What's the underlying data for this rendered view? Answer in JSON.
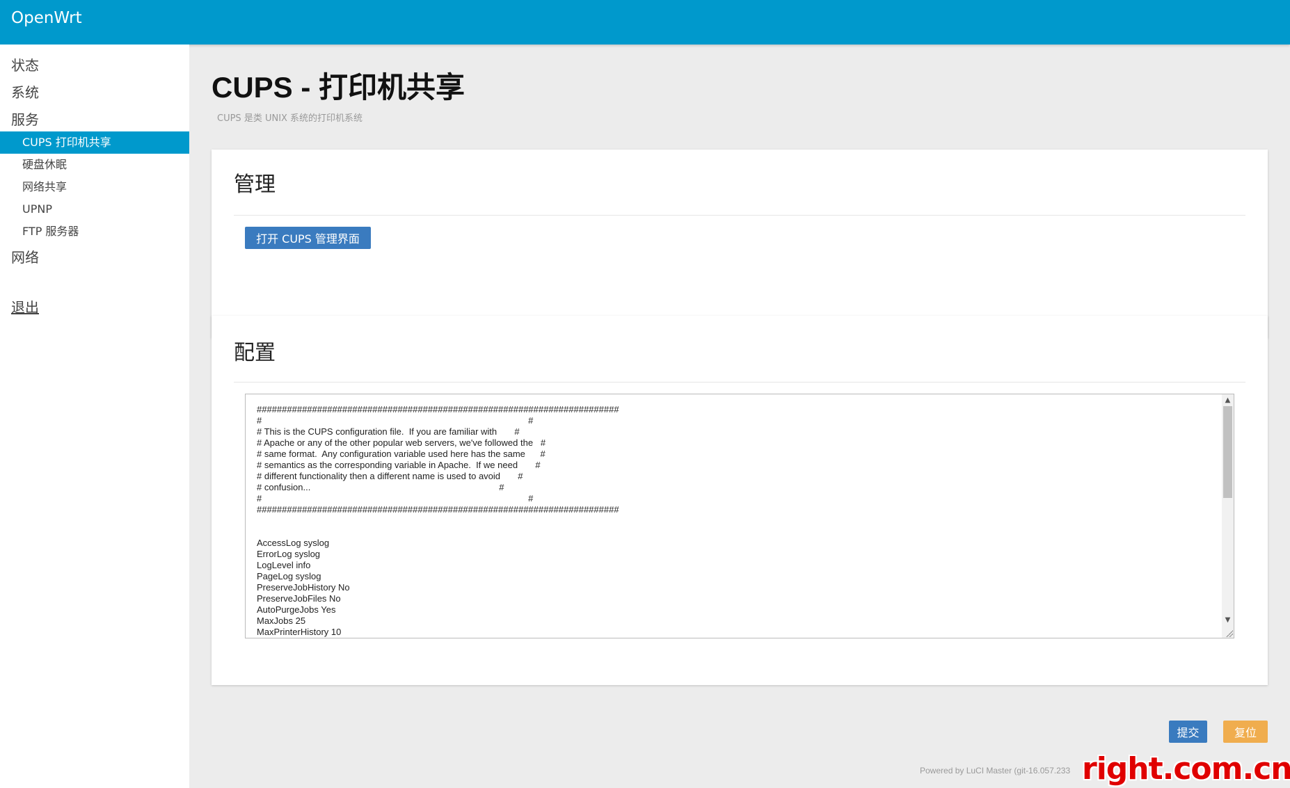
{
  "header": {
    "brand": "OpenWrt"
  },
  "sidebar": {
    "status": "状态",
    "system": "系统",
    "services": "服务",
    "services_items": [
      "CUPS 打印机共享",
      "硬盘休眠",
      "网络共享",
      "UPNP",
      "FTP 服务器"
    ],
    "network": "网络",
    "logout": "退出"
  },
  "page": {
    "title": "CUPS - 打印机共享",
    "description": "CUPS 是类 UNIX 系统的打印机系统"
  },
  "manage_section": {
    "title": "管理",
    "open_button": "打开 CUPS 管理界面"
  },
  "config_section": {
    "title": "配置",
    "content": "########################################################################\n#                                                                                                          #\n# This is the CUPS configuration file.  If you are familiar with       #\n# Apache or any of the other popular web servers, we've followed the   #\n# same format.  Any configuration variable used here has the same      #\n# semantics as the corresponding variable in Apache.  If we need       #\n# different functionality then a different name is used to avoid       #\n# confusion...                                                                           #\n#                                                                                                          #\n########################################################################\n\n\nAccessLog syslog\nErrorLog syslog\nLogLevel info\nPageLog syslog\nPreserveJobHistory No\nPreserveJobFiles No\nAutoPurgeJobs Yes\nMaxJobs 25\nMaxPrinterHistory 10"
  },
  "actions": {
    "submit": "提交",
    "reset": "复位"
  },
  "footer": {
    "text": "Powered by LuCI Master (git-16.057.233"
  },
  "watermark": {
    "text": "right.com.cn"
  },
  "colors": {
    "header": "#0099cc",
    "active_nav": "#0099cc",
    "primary_button": "#3a7bbf",
    "reset_button": "#f0ad4e",
    "watermark": "#e00000"
  }
}
